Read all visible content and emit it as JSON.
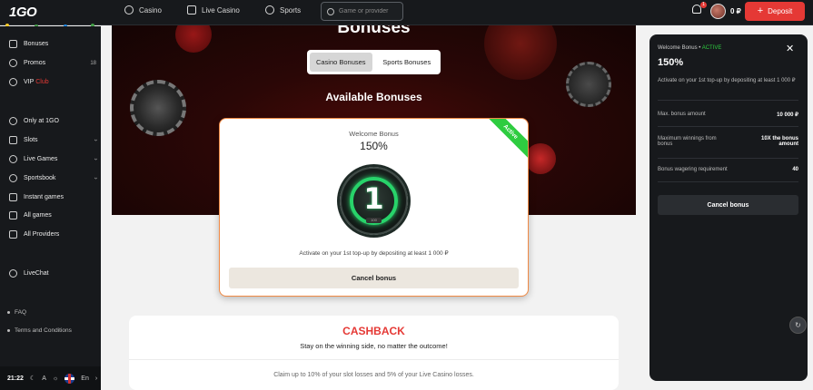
{
  "header": {
    "logo": "1GO",
    "nav": [
      {
        "label": "Casino",
        "icon": "casino-icon"
      },
      {
        "label": "Live Casino",
        "icon": "live-casino-icon"
      },
      {
        "label": "Sports",
        "icon": "sports-icon"
      }
    ],
    "search_placeholder": "Game or provider",
    "notifications_badge": "1",
    "balance": "0 ₽",
    "deposit_label": "Deposit"
  },
  "sidebar": {
    "items": [
      {
        "label": "Bonuses",
        "icon": "gift-icon"
      },
      {
        "label": "Promos",
        "icon": "star-icon",
        "count": "18"
      },
      {
        "label": "VIP",
        "label_suffix": "Club",
        "icon": "crown-icon"
      },
      {
        "label": "Only at 1GO",
        "icon": "1go-icon"
      },
      {
        "label": "Slots",
        "icon": "slots-icon"
      },
      {
        "label": "Live Games",
        "icon": "live-games-icon"
      },
      {
        "label": "Sportsbook",
        "icon": "sportsbook-icon"
      },
      {
        "label": "Instant games",
        "icon": "lightning-icon"
      },
      {
        "label": "All games",
        "icon": "grid-icon"
      },
      {
        "label": "All Providers",
        "icon": "providers-icon"
      },
      {
        "label": "LiveChat",
        "icon": "headset-icon"
      }
    ],
    "footer": [
      "FAQ",
      "Terms and Conditions"
    ],
    "time": "21:22",
    "font_toggle": "A",
    "language": "En"
  },
  "hero": {
    "title": "Bonuses",
    "tabs": [
      "Casino Bonuses",
      "Sports Bonuses"
    ],
    "active_tab": "Casino Bonuses",
    "section_title": "Available Bonuses"
  },
  "bonus_card": {
    "ribbon": "Active",
    "name": "Welcome Bonus",
    "percent": "150%",
    "medal_number": "1",
    "medal_small": "100",
    "description": "Activate on your 1st top-up by depositing at least 1 000 ₽",
    "button": "Cancel bonus"
  },
  "cashback": {
    "title": "CASHBACK",
    "subtitle": "Stay on the winning side, no matter the outcome!",
    "description": "Claim up to 10% of your slot losses and 5% of your Live Casino losses."
  },
  "panel": {
    "name": "Welcome Bonus",
    "status": "ACTIVE",
    "percent": "150%",
    "description": "Activate on your 1st top-up by depositing at least 1 000 ₽",
    "rows": [
      {
        "label": "Max. bonus amount",
        "value": "10 000 ₽"
      },
      {
        "label": "Maximum winnings from bonus",
        "value": "10X the bonus amount"
      },
      {
        "label": "Bonus wagering requirement",
        "value": "40"
      }
    ],
    "button": "Cancel bonus"
  },
  "colors": {
    "accent": "#e53935",
    "active_green": "#2ecc40",
    "card_border": "#f08a45"
  }
}
